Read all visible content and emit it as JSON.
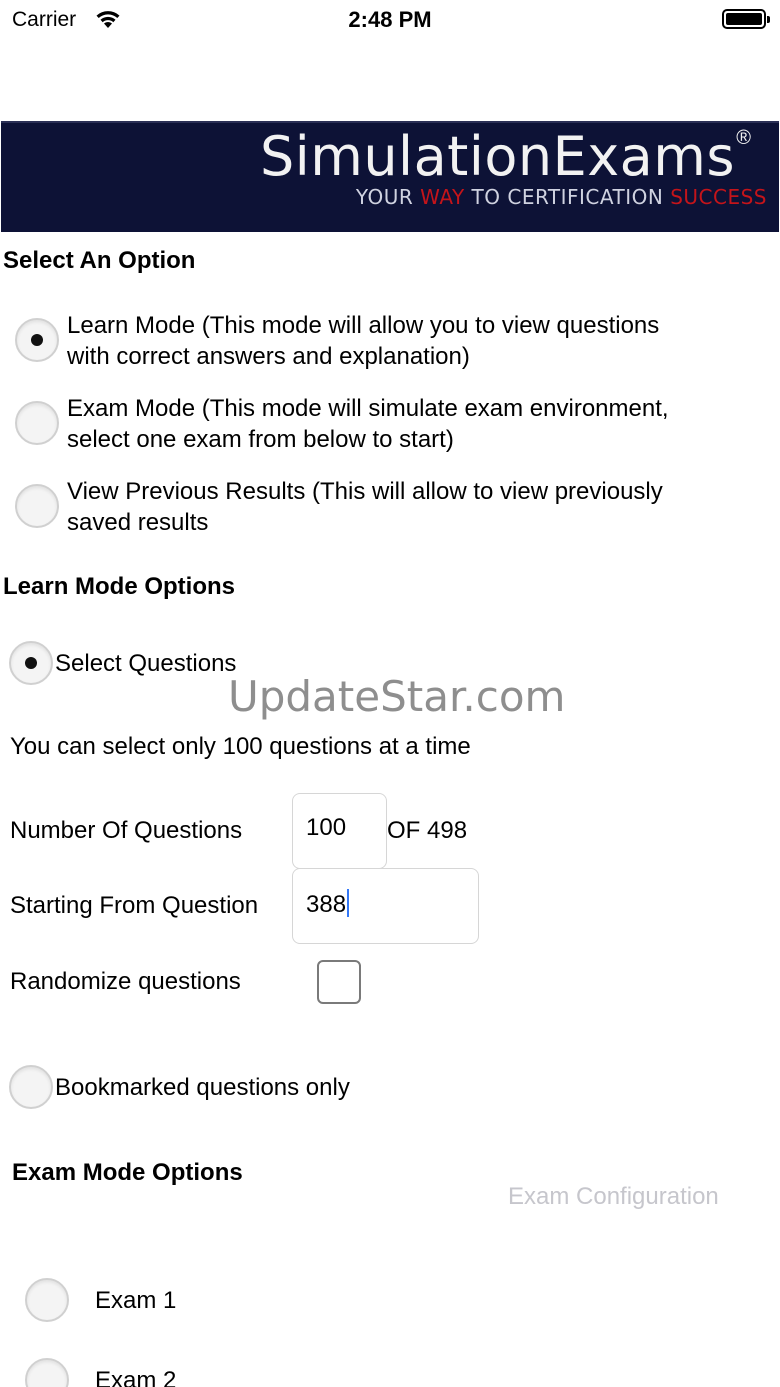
{
  "status_bar": {
    "carrier": "Carrier",
    "time": "2:48 PM"
  },
  "banner": {
    "title": "SimulationExams",
    "registered": "®",
    "tagline_1": "YOUR ",
    "tagline_way": "WAY",
    "tagline_2": " TO CERTIFICATION ",
    "tagline_success": "SUCCESS",
    "background_color": "#0d1236",
    "accent_color": "#c4141a"
  },
  "select_option": {
    "heading": "Select An Option",
    "options": [
      {
        "line1": "Learn Mode (This mode will allow you to view questions",
        "line2": "with correct answers and explanation)",
        "selected": true
      },
      {
        "line1": "Exam Mode (This mode will simulate exam environment,",
        "line2": "select one exam from below to start)",
        "selected": false
      },
      {
        "line1": "View Previous Results (This will allow to view previously",
        "line2": "saved results",
        "selected": false
      }
    ]
  },
  "learn_mode": {
    "heading": "Learn Mode Options",
    "select_questions_label": "Select Questions",
    "info": "You can select only 100 questions at a time",
    "number_label": "Number Of Questions",
    "number_value": "100",
    "of_total": "OF 498",
    "start_label": "Starting From Question",
    "start_value": "388",
    "randomize_label": "Randomize questions",
    "bookmarked_label": "Bookmarked questions only"
  },
  "watermark": "UpdateStar.com",
  "exam_mode": {
    "heading": "Exam Mode Options",
    "config_link": "Exam Configuration",
    "exams": [
      "Exam 1",
      "Exam 2"
    ]
  }
}
